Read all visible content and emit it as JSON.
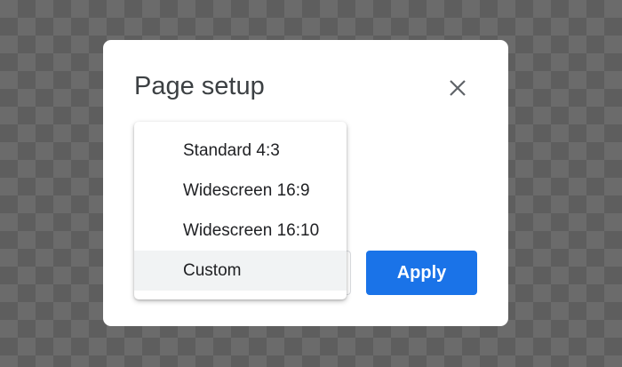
{
  "dialog": {
    "title": "Page setup",
    "close_icon": "close-icon",
    "apply_label": "Apply"
  },
  "menu": {
    "items": [
      {
        "label": "Standard 4:3"
      },
      {
        "label": "Widescreen 16:9"
      },
      {
        "label": "Widescreen 16:10"
      },
      {
        "label": "Custom"
      }
    ],
    "highlighted": "Custom"
  },
  "colors": {
    "accent": "#1a73e8",
    "highlight": "#f1f3f4"
  }
}
